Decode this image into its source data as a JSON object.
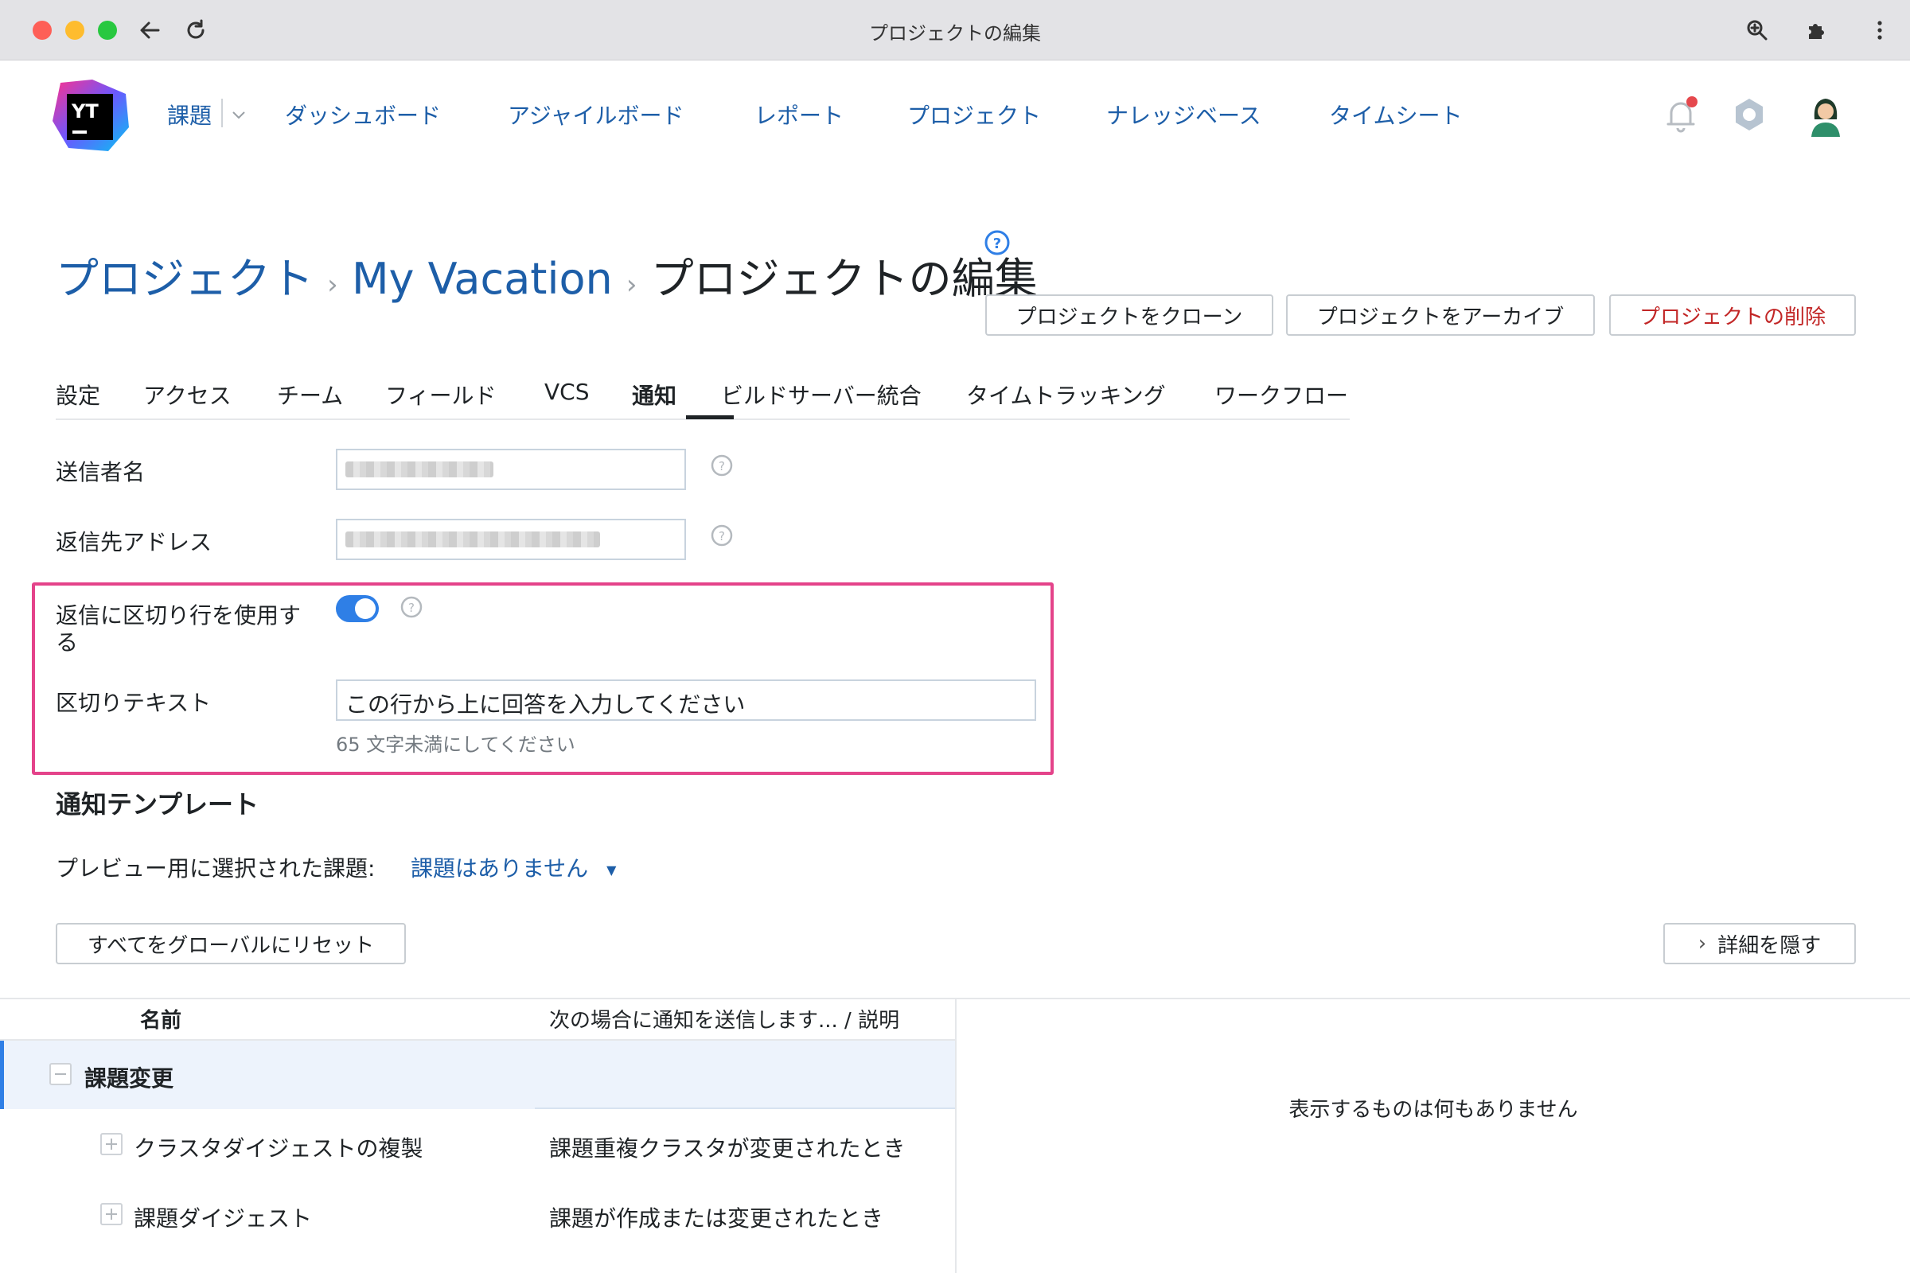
{
  "browser": {
    "title": "プロジェクトの編集",
    "icons": [
      "back-arrow-icon",
      "reload-icon",
      "zoom-icon",
      "extensions-icon",
      "more-vertical-icon"
    ]
  },
  "header": {
    "nav": [
      "課題",
      "ダッシュボード",
      "アジャイルボード",
      "レポート",
      "プロジェクト",
      "ナレッジベース",
      "タイムシート"
    ],
    "logo_text": "YT",
    "notification_dot_color": "#e5484d"
  },
  "breadcrumb": {
    "root": "プロジェクト",
    "project": "My Vacation",
    "current": "プロジェクトの編集",
    "arrow": "›"
  },
  "actions": {
    "clone": "プロジェクトをクローン",
    "archive": "プロジェクトをアーカイブ",
    "delete": "プロジェクトの削除"
  },
  "tabs": [
    "設定",
    "アクセス",
    "チーム",
    "フィールド",
    "VCS",
    "通知",
    "ビルドサーバー統合",
    "タイムトラッキング",
    "ワークフロー"
  ],
  "active_tab": "通知",
  "form": {
    "sender_name_label": "送信者名",
    "reply_to_label": "返信先アドレス",
    "use_separator_label_1": "返信に区切り行を使用す",
    "use_separator_label_2": "る",
    "use_separator_on": true,
    "separator_text_label": "区切りテキスト",
    "separator_text_value": "この行から上に回答を入力してください",
    "separator_hint": "65 文字未満にしてください"
  },
  "templates": {
    "heading": "通知テンプレート",
    "preview_label": "プレビュー用に選択された課題:",
    "preview_value": "課題はありません",
    "reset_button": "すべてをグローバルにリセット",
    "hide_details_button": "詳細を隠す"
  },
  "table": {
    "col_name": "名前",
    "col_desc": "次の場合に通知を送信します... / 説明",
    "group": "課題変更",
    "rows": [
      {
        "name": "クラスタダイジェストの複製",
        "desc": "課題重複クラスタが変更されたとき"
      },
      {
        "name": "課題ダイジェスト",
        "desc": "課題が作成または変更されたとき"
      }
    ],
    "empty_message": "表示するものは何もありません"
  }
}
